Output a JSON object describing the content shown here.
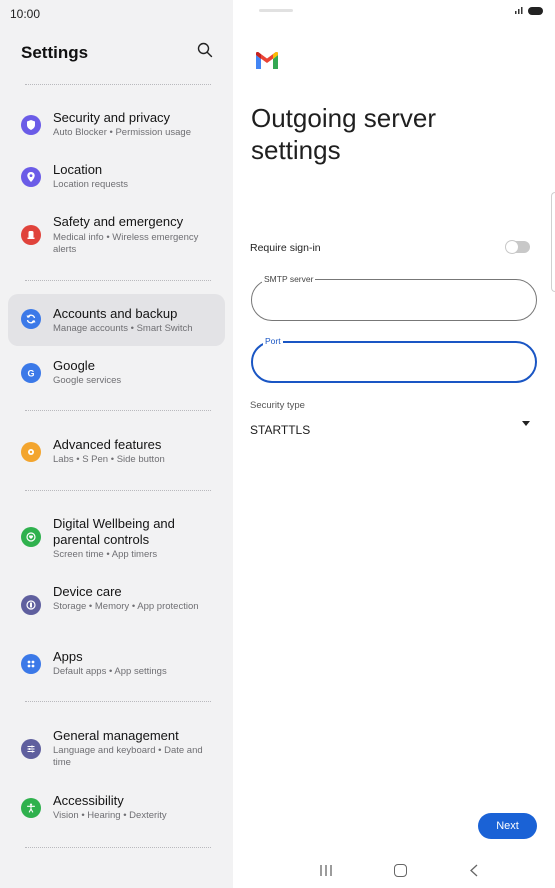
{
  "status": {
    "time": "10:00"
  },
  "settings": {
    "title": "Settings",
    "items": [
      {
        "id": "security",
        "title": "Security and privacy",
        "subtitle": "Auto Blocker • Permission usage",
        "icon": "shield-icon",
        "color": "#6b5ce7"
      },
      {
        "id": "location",
        "title": "Location",
        "subtitle": "Location requests",
        "icon": "location-pin-icon",
        "color": "#6b5ce7"
      },
      {
        "id": "safety",
        "title": "Safety and emergency",
        "subtitle": "Medical info • Wireless emergency alerts",
        "icon": "emergency-icon",
        "color": "#e0433b"
      },
      {
        "id": "accounts",
        "title": "Accounts and backup",
        "subtitle": "Manage accounts • Smart Switch",
        "icon": "sync-icon",
        "color": "#3b79e8",
        "active": true
      },
      {
        "id": "google",
        "title": "Google",
        "subtitle": "Google services",
        "icon": "google-icon",
        "color": "#3b79e8"
      },
      {
        "id": "advanced",
        "title": "Advanced features",
        "subtitle": "Labs • S Pen • Side button",
        "icon": "gear-plus-icon",
        "color": "#f3a52e"
      },
      {
        "id": "wellbeing",
        "title": "Digital Wellbeing and parental controls",
        "subtitle": "Screen time • App timers",
        "icon": "heart-circle-icon",
        "color": "#2fb14d"
      },
      {
        "id": "devicecare",
        "title": "Device care",
        "subtitle": "Storage • Memory • App protection",
        "icon": "device-care-icon",
        "color": "#5f5f9e"
      },
      {
        "id": "apps",
        "title": "Apps",
        "subtitle": "Default apps • App settings",
        "icon": "apps-grid-icon",
        "color": "#3b79e8"
      },
      {
        "id": "general",
        "title": "General management",
        "subtitle": "Language and keyboard • Date and time",
        "icon": "sliders-icon",
        "color": "#5f5f9e"
      },
      {
        "id": "accessibility",
        "title": "Accessibility",
        "subtitle": "Vision • Hearing • Dexterity",
        "icon": "accessibility-icon",
        "color": "#2fb14d"
      }
    ]
  },
  "email": {
    "title": "Outgoing server settings",
    "require_signin_label": "Require sign-in",
    "require_signin_on": false,
    "smtp_label": "SMTP server",
    "smtp_value": "",
    "port_label": "Port",
    "port_value": "",
    "security_label": "Security type",
    "security_value": "STARTTLS",
    "next_label": "Next"
  }
}
